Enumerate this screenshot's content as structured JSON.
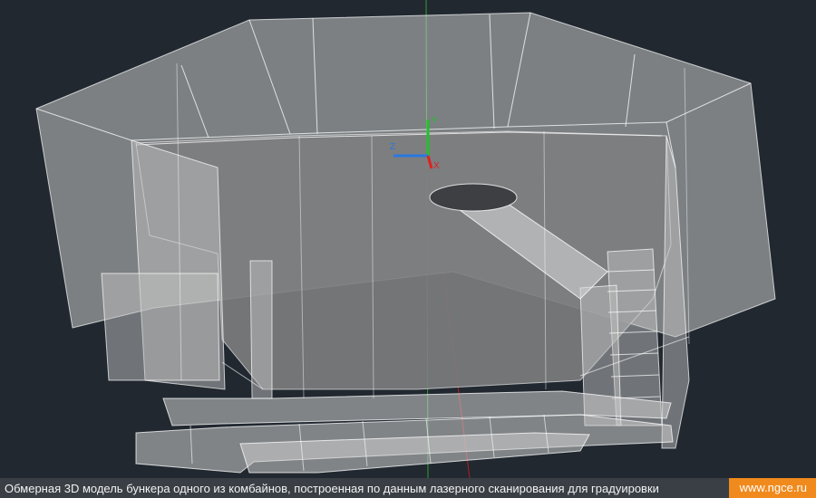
{
  "viewport": {
    "background": "#212830",
    "model_color": "#c8c8c8",
    "edge_color": "#ffffff",
    "axis_colors": {
      "x": "#e02020",
      "y": "#22c02a",
      "z": "#2a78e0"
    },
    "ucs_icon": "ucs-axis-tripod-icon"
  },
  "caption": {
    "text": "Обмерная 3D модель бункера одного из комбайнов, построенная по данным лазерного сканирования для градуировки",
    "site": "www.ngce.ru",
    "accent": "#f08a1c"
  }
}
